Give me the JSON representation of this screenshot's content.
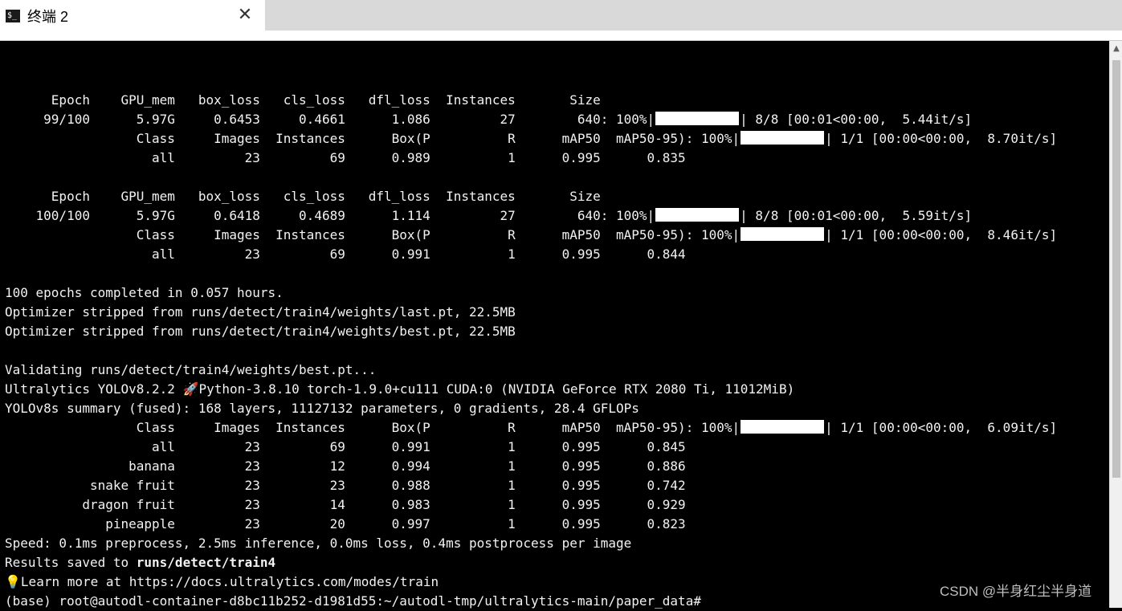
{
  "tab": {
    "icon_text": "$_",
    "title": "终端 2",
    "close_glyph": "✕"
  },
  "lines": [
    "",
    "      Epoch    GPU_mem   box_loss   cls_loss   dfl_loss  Instances       Size",
    "     99/100      5.97G     0.6453     0.4661      1.086         27        640: 100%|{BAR}| 8/8 [00:01<00:00,  5.44it/s]",
    "                 Class     Images  Instances      Box(P          R      mAP50  mAP50-95): 100%|{BAR}| 1/1 [00:00<00:00,  8.70it/s]",
    "                   all         23         69      0.989          1      0.995      0.835",
    "",
    "      Epoch    GPU_mem   box_loss   cls_loss   dfl_loss  Instances       Size",
    "    100/100      5.97G     0.6418     0.4689      1.114         27        640: 100%|{BAR}| 8/8 [00:01<00:00,  5.59it/s]",
    "                 Class     Images  Instances      Box(P          R      mAP50  mAP50-95): 100%|{BAR}| 1/1 [00:00<00:00,  8.46it/s]",
    "                   all         23         69      0.991          1      0.995      0.844",
    "",
    "100 epochs completed in 0.057 hours.",
    "Optimizer stripped from runs/detect/train4/weights/last.pt, 22.5MB",
    "Optimizer stripped from runs/detect/train4/weights/best.pt, 22.5MB",
    "",
    "Validating runs/detect/train4/weights/best.pt...",
    "Ultralytics YOLOv8.2.2 🚀Python-3.8.10 torch-1.9.0+cu111 CUDA:0 (NVIDIA GeForce RTX 2080 Ti, 11012MiB)",
    "YOLOv8s summary (fused): 168 layers, 11127132 parameters, 0 gradients, 28.4 GFLOPs",
    "                 Class     Images  Instances      Box(P          R      mAP50  mAP50-95): 100%|{BAR}| 1/1 [00:00<00:00,  6.09it/s]",
    "                   all         23         69      0.991          1      0.995      0.845",
    "                banana         23         12      0.994          1      0.995      0.886",
    "           snake fruit         23         23      0.988          1      0.995      0.742",
    "          dragon fruit         23         14      0.983          1      0.995      0.929",
    "             pineapple         23         20      0.997          1      0.995      0.823",
    "Speed: 0.1ms preprocess, 2.5ms inference, 0.0ms loss, 0.4ms postprocess per image",
    "Results saved to {B}runs/detect/train4{/B}",
    "💡Learn more at https://docs.ultralytics.com/modes/train",
    "(base) root@autodl-container-d8bc11b252-d1981d55:~/autodl-tmp/ultralytics-main/paper_data#"
  ],
  "progress": {
    "value": 100,
    "unit": "%"
  },
  "watermark": "CSDN @半身红尘半身道"
}
